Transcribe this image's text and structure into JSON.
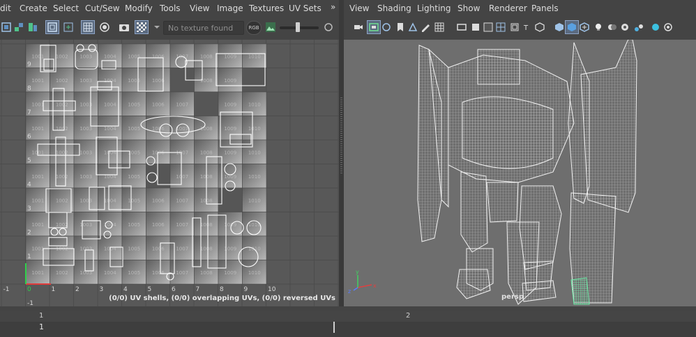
{
  "uv_editor": {
    "menu": [
      "dit",
      "Create",
      "Select",
      "Cut/Sew",
      "Modify",
      "Tools",
      "View",
      "Image",
      "Textures",
      "UV Sets"
    ],
    "overflow_arrow": "»",
    "toolbar_icons": [
      "uv-shell-icon",
      "flip-u-icon",
      "flip-v-icon",
      "rotate-icon",
      "isolate-select-icon",
      "frame-icon",
      "grid-icon",
      "shaded-icon",
      "snapshot-icon",
      "checker-icon",
      "dropdown-arrow-icon",
      "texture-field",
      "rgb-channel-icon",
      "exposure-icon",
      "gamma-slider"
    ],
    "texture_field": "No texture found",
    "rgb_label": "RGB",
    "status": "(0/0) UV shells, (0/0) overlapping UVs, (0/0) reversed UVs",
    "grid": {
      "u_labels": [
        "-1",
        "0",
        "1",
        "2",
        "3",
        "4",
        "5",
        "6",
        "7",
        "8",
        "9",
        "10"
      ],
      "v_labels": [
        "9",
        "8",
        "7",
        "6",
        "5",
        "4",
        "3",
        "2",
        "1",
        "-1"
      ],
      "cell_texts": [
        "1001",
        "1002",
        "1003",
        "1004",
        "1005",
        "1006",
        "1007",
        "1008",
        "1009",
        "1010"
      ]
    },
    "colors": {
      "axis_u": "#e23a3a",
      "axis_v": "#2fd04a",
      "tile_dark": "#5e5e5e",
      "tile_light": "#b8b8b8"
    }
  },
  "viewport": {
    "menu": [
      "View",
      "Shading",
      "Lighting",
      "Show",
      "Renderer",
      "Panels"
    ],
    "toolbar_icons": [
      "select-camera-icon",
      "camera-attributes-icon",
      "bookmark-icon",
      "image-plane-icon",
      "2d-pan-icon",
      "grease-pencil-icon",
      "grid-icon",
      "film-gate-icon",
      "resolution-gate-icon",
      "gate-mask-icon",
      "field-chart-icon",
      "safe-action-icon",
      "safe-title-icon",
      "wireframe-icon",
      "smooth-shade-icon",
      "default-material-icon",
      "textured-icon",
      "use-all-lights-icon",
      "shadows-icon",
      "ambient-occlusion-icon",
      "antialiasing-icon",
      "isolate-icon",
      "xray-icon"
    ],
    "camera": "persp",
    "axis_labels": {
      "x": "x",
      "y": "y",
      "z": "z"
    },
    "colors": {
      "background": "#6e6e6e",
      "wireframe": "#f2f2f2",
      "selected": "#6ee8a6"
    }
  },
  "timeline": {
    "start_label": "1",
    "end_label": "2",
    "current_frame": "1"
  }
}
